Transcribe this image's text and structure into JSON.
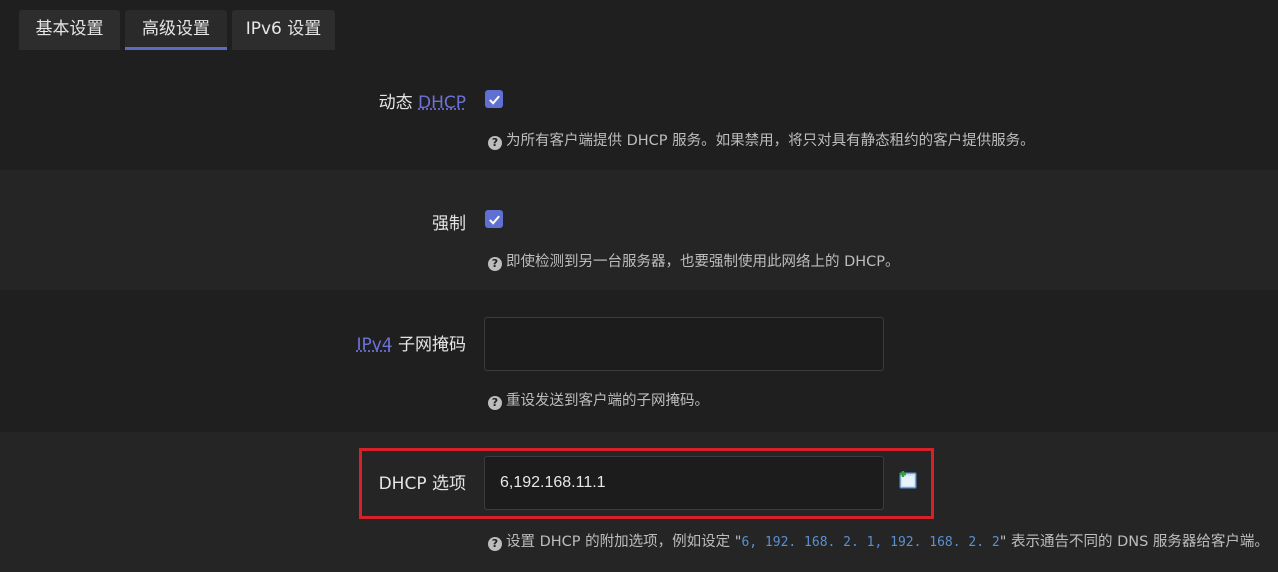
{
  "tabs": [
    {
      "label": "基本设置"
    },
    {
      "label": "高级设置"
    },
    {
      "label": "IPv6 设置"
    }
  ],
  "dynamic_dhcp": {
    "label_prefix": "动态 ",
    "label_abbr": "DHCP",
    "checked": true,
    "help": "为所有客户端提供 DHCP 服务。如果禁用，将只对具有静态租约的客户提供服务。"
  },
  "force": {
    "label": "强制",
    "checked": true,
    "help": "即使检测到另一台服务器，也要强制使用此网络上的 DHCP。"
  },
  "ipv4_netmask": {
    "label_abbr": "IPv4",
    "label_suffix": " 子网掩码",
    "value": "",
    "help": "重设发送到客户端的子网掩码。"
  },
  "dhcp_options": {
    "label": "DHCP 选项",
    "value": "6,192.168.11.1",
    "help_prefix": "设置 DHCP 的附加选项，例如设定 \"",
    "help_code": "6, 192. 168. 2. 1, 192. 168. 2. 2",
    "help_suffix": "\" 表示通告不同的 DNS 服务器给客户端。",
    "add_icon": "add-entry-icon"
  },
  "colors": {
    "accent": "#5f6fd2",
    "highlight": "#d6202a",
    "link": "#6d72d8"
  }
}
